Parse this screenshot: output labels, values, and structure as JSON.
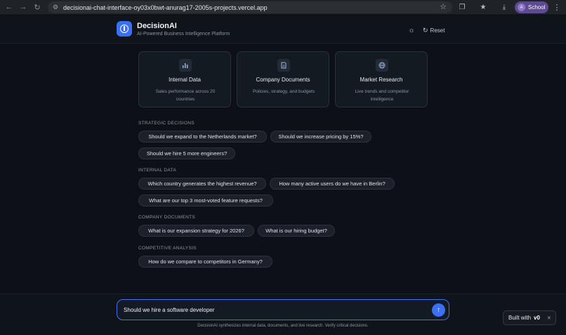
{
  "browser": {
    "url": "decisionai-chat-interface-oy03x0bwt-anurag17-2005s-projects.vercel.app",
    "profile_initial": "A",
    "profile_label": "School",
    "icons": [
      "back-arrow-icon",
      "forward-arrow-icon",
      "reload-icon",
      "site-info-icon",
      "bookmark-star-icon",
      "extensions-icon",
      "tab-search-icon",
      "downloads-icon",
      "more-menu-icon"
    ]
  },
  "header": {
    "title": "DecisionAI",
    "subtitle": "AI-Powered Business Intelligence Platform",
    "reset_label": "Reset"
  },
  "cards": [
    {
      "icon": "bar-chart-icon",
      "title": "Internal Data",
      "description": "Sales performance across 20 countries"
    },
    {
      "icon": "document-icon",
      "title": "Company Documents",
      "description": "Policies, strategy, and budgets"
    },
    {
      "icon": "globe-icon",
      "title": "Market Research",
      "description": "Live trends and competitor intelligence"
    }
  ],
  "sections": [
    {
      "label": "STRATEGIC DECISIONS",
      "questions": [
        "Should we expand to the Netherlands market?",
        "Should we increase pricing by 15%?",
        "Should we hire 5 more engineers?"
      ]
    },
    {
      "label": "INTERNAL DATA",
      "questions": [
        "Which country generates the highest revenue?",
        "How many active users do we have in Berlin?",
        "What are our top 3 most-voted feature requests?"
      ]
    },
    {
      "label": "COMPANY DOCUMENTS",
      "questions": [
        "What is our expansion strategy for 2026?",
        "What is our hiring budget?"
      ]
    },
    {
      "label": "COMPETITIVE ANALYSIS",
      "questions": [
        "How do we compare to competitors in Germany?"
      ]
    }
  ],
  "composer": {
    "value": "Should we hire a software developer"
  },
  "disclaimer": "DecisionAI synthesizes internal data, documents, and live research. Verify critical decisions.",
  "badge": {
    "label": "Built with",
    "logo_text": "v0"
  },
  "colors": {
    "background": "#0d1117",
    "accent": "#3b6ff5",
    "card": "#141a22",
    "chip": "#1b2029"
  }
}
